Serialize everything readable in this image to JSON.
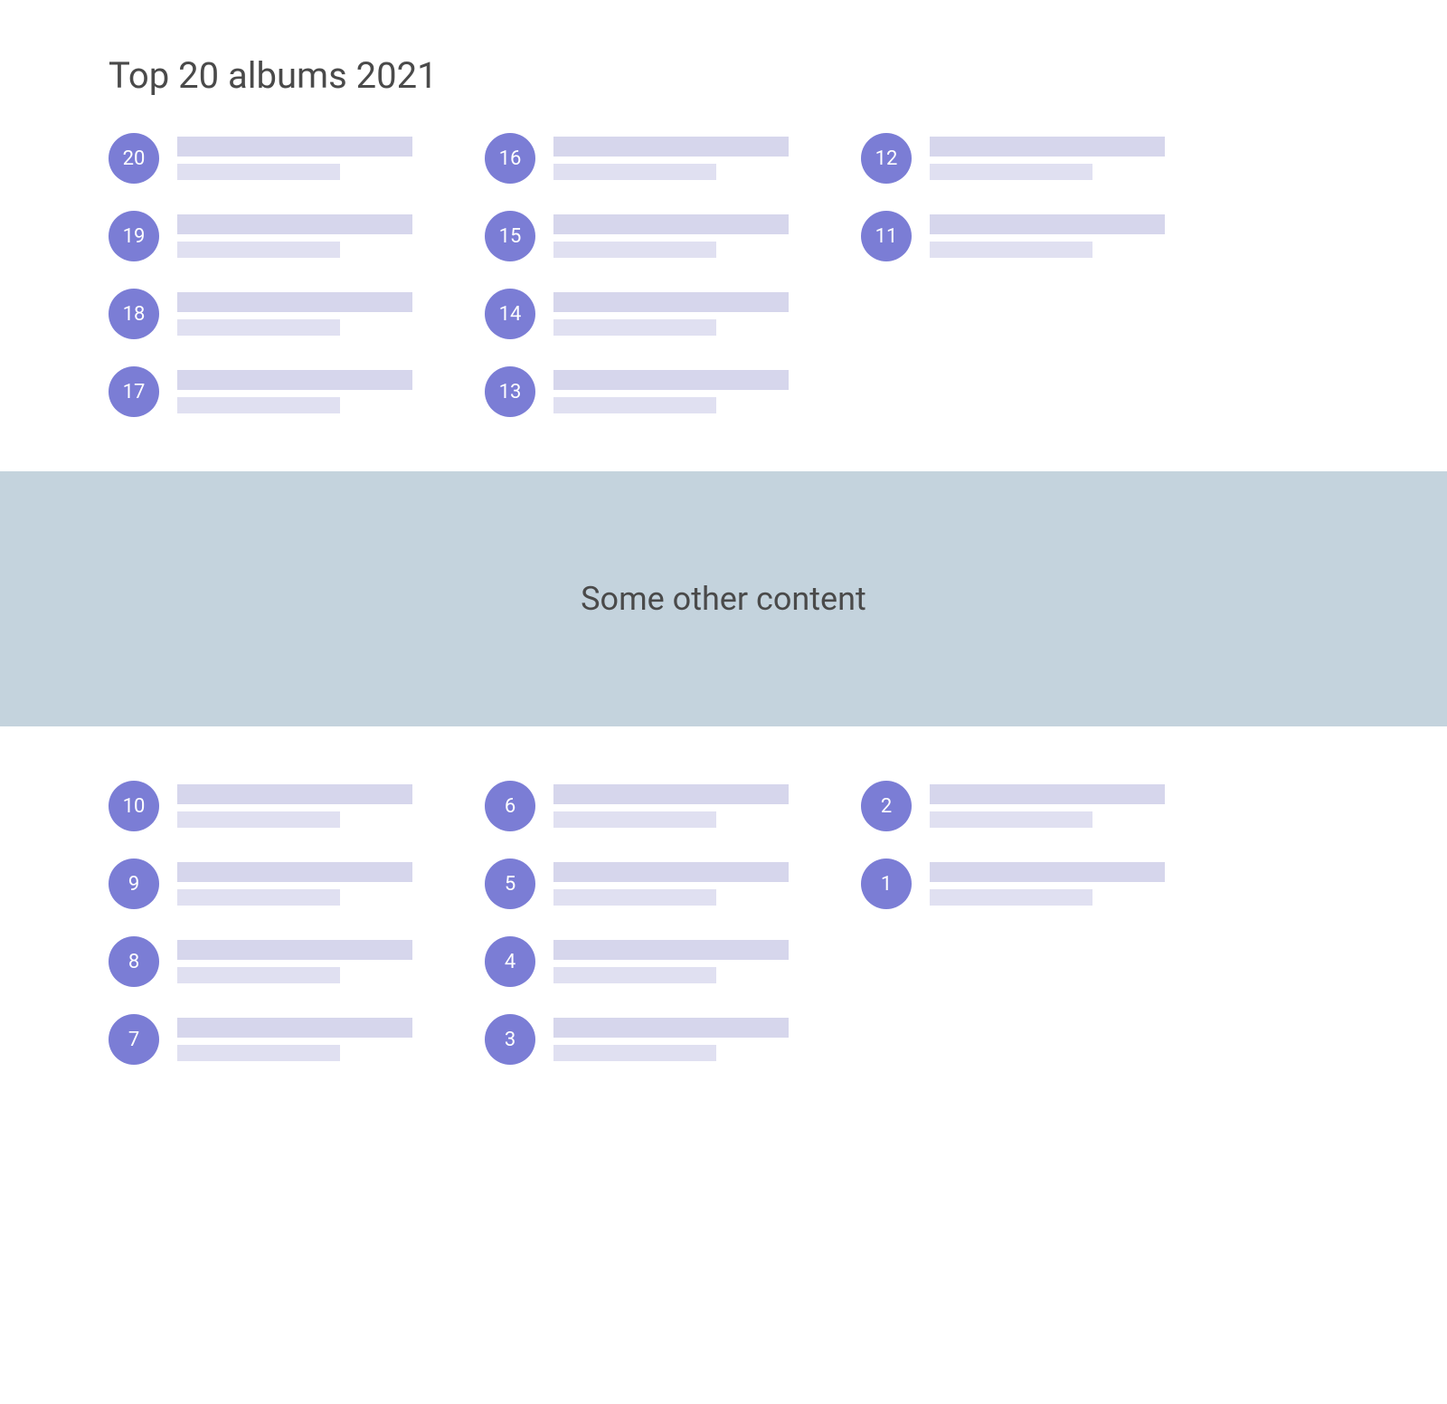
{
  "heading": "Top 20 albums 2021",
  "banner": {
    "text": "Some other content"
  },
  "upper": {
    "col1": [
      "20",
      "19",
      "18",
      "17"
    ],
    "col2": [
      "16",
      "15",
      "14",
      "13"
    ],
    "col3": [
      "12",
      "11"
    ]
  },
  "lower": {
    "col1": [
      "10",
      "9",
      "8",
      "7"
    ],
    "col2": [
      "6",
      "5",
      "4",
      "3"
    ],
    "col3": [
      "2",
      "1"
    ]
  }
}
